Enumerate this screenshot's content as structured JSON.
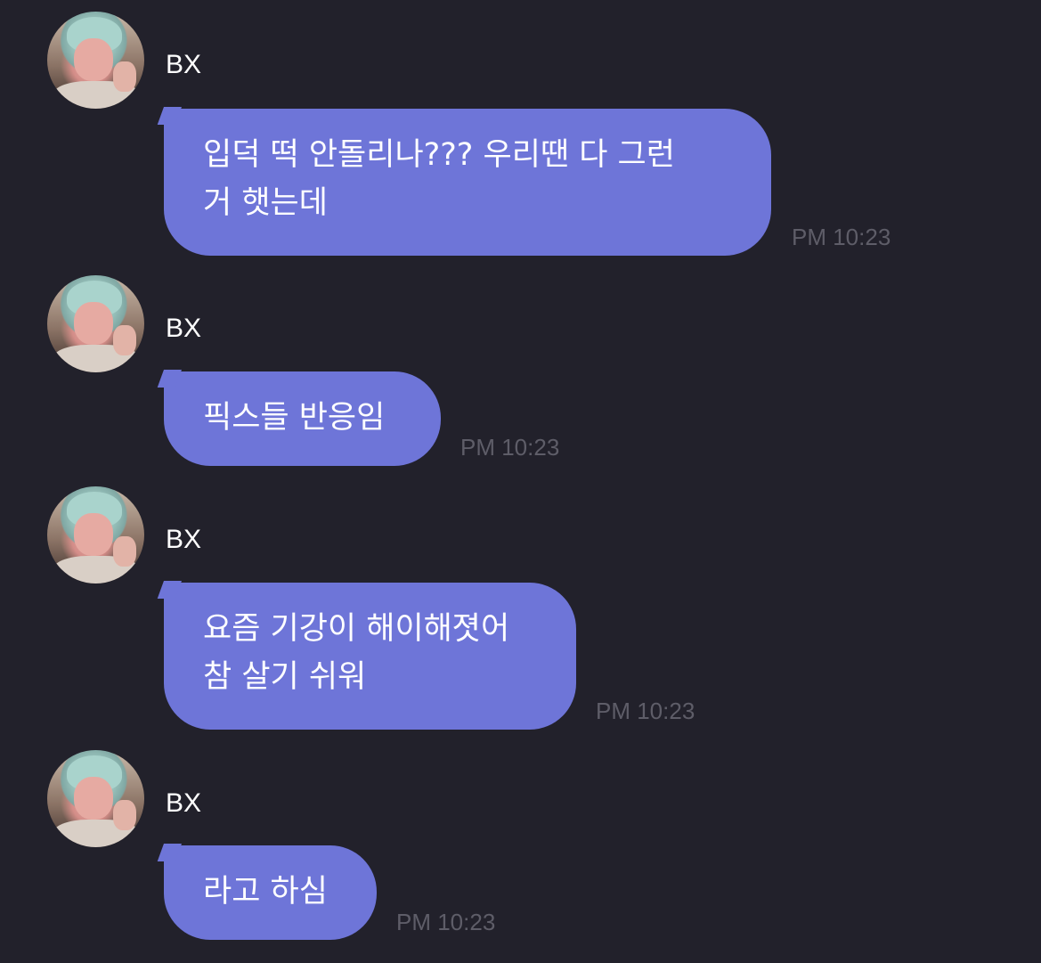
{
  "messages": [
    {
      "sender": "BX",
      "text": "입덕 떡 안돌리나??? 우리땐 다 그런\n거 햇는데",
      "time": "PM 10:23"
    },
    {
      "sender": "BX",
      "text": "픽스들 반응임",
      "time": "PM 10:23"
    },
    {
      "sender": "BX",
      "text": "요즘 기강이 해이해졋어\n참 살기 쉬워",
      "time": "PM 10:23"
    },
    {
      "sender": "BX",
      "text": "라고 하심",
      "time": "PM 10:23"
    }
  ],
  "colors": {
    "background": "#22212b",
    "bubble": "#6e75d8",
    "timestamp": "#5e5d68",
    "name": "#ffffff"
  }
}
